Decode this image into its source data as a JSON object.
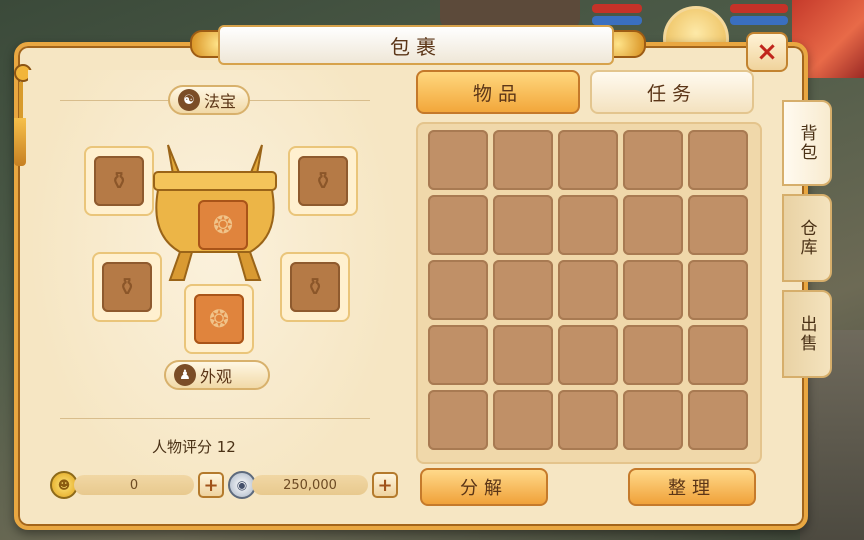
{
  "window": {
    "title": "包裹",
    "close_icon": "×"
  },
  "left": {
    "fabao_label": "法宝",
    "fabao_icon": "☯",
    "appearance_label": "外观",
    "appearance_icon": "♟",
    "score_label": "人物评分 12",
    "slot_glyph": "⚱",
    "center_glyph": "❂"
  },
  "currency": {
    "gold": {
      "value": "0",
      "icon": "☻"
    },
    "silver": {
      "value": "250,000",
      "icon": "◉"
    },
    "plus": "+"
  },
  "tabs": [
    {
      "label": "物品",
      "active": true
    },
    {
      "label": "任务",
      "active": false
    }
  ],
  "grid": {
    "rows": 5,
    "cols": 5
  },
  "actions": {
    "decompose": "分解",
    "sort": "整理"
  },
  "side_tabs": [
    {
      "label": "背包",
      "active": true
    },
    {
      "label": "仓库",
      "active": false
    },
    {
      "label": "出售",
      "active": false
    }
  ],
  "colors": {
    "accent": "#f2a73b",
    "panel": "#f6e6c3",
    "slot": "#b57a46",
    "close": "#c0251c"
  }
}
